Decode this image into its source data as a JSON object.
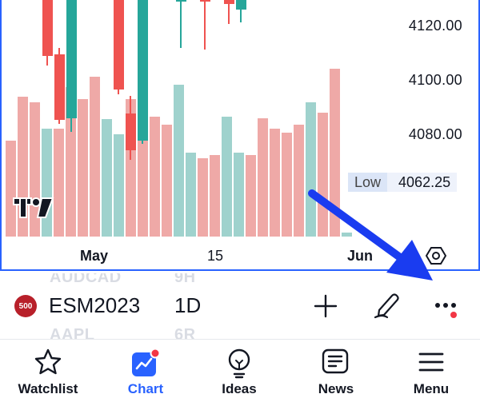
{
  "chart": {
    "price_axis": [
      "4120.00",
      "4100.00",
      "4080.00"
    ],
    "low_tag": {
      "label": "Low",
      "value": "4062.25"
    },
    "time_axis": [
      "May",
      "15",
      "Jun"
    ],
    "colors": {
      "up": "#26a69a",
      "down": "#ef5350",
      "vol_up": "#9fd2cd",
      "vol_down": "#efa9a7",
      "frame": "#2962ff"
    }
  },
  "symbol_bar": {
    "badge": "500",
    "symbol": "ESM2023",
    "interval": "1D",
    "ghost_rows": [
      {
        "symbol": "AUDCAD",
        "interval": "9H"
      },
      {
        "symbol": "AAPL",
        "interval": "6R"
      }
    ],
    "icons": [
      "plus-icon",
      "pen-icon",
      "more-dots-icon"
    ]
  },
  "tabs": [
    {
      "label": "Watchlist",
      "icon": "star-icon",
      "active": false
    },
    {
      "label": "Chart",
      "icon": "chart-icon",
      "active": true
    },
    {
      "label": "Ideas",
      "icon": "lightbulb-icon",
      "active": false
    },
    {
      "label": "News",
      "icon": "news-icon",
      "active": false
    },
    {
      "label": "Menu",
      "icon": "hamburger-icon",
      "active": false
    }
  ],
  "annotation": {
    "color": "#1a3cf0",
    "points_to": "more-dots-icon"
  }
}
